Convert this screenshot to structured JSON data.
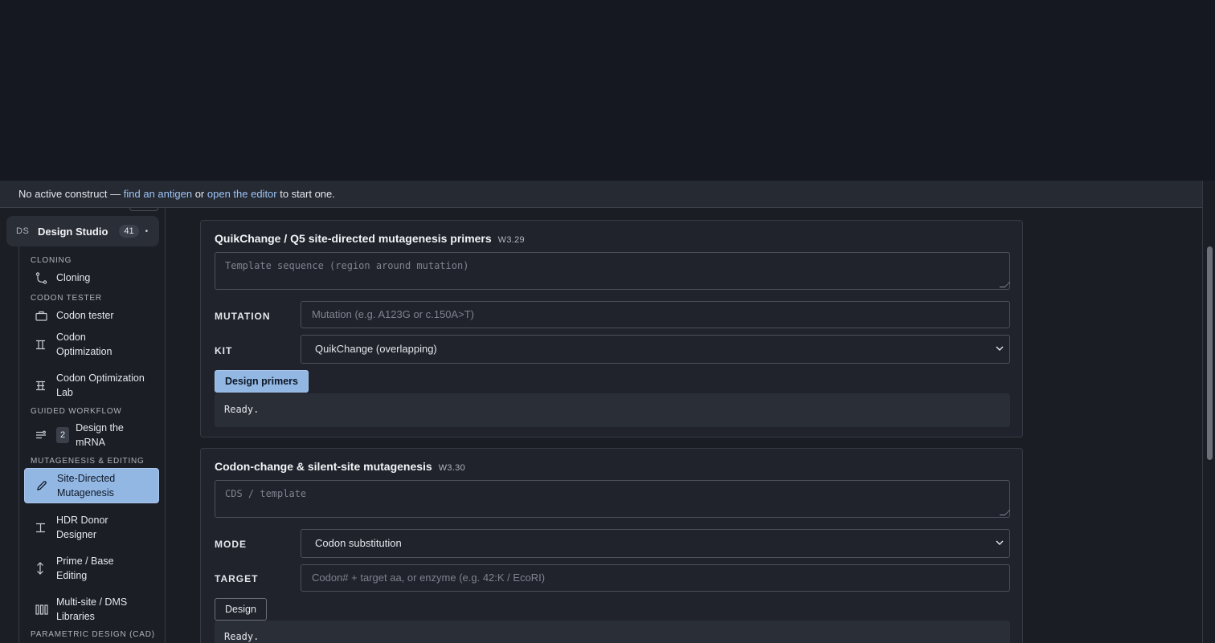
{
  "banner": {
    "prefix": "No active construct — ",
    "link1": "find an antigen",
    "middle": " or ",
    "link2": "open the editor",
    "suffix": " to start one."
  },
  "sidebar": {
    "header": {
      "abbr": "DS",
      "title": "Design Studio",
      "count": "41",
      "dot": "•"
    },
    "sections": {
      "cloning": "CLONING",
      "codon_tester": "CODON TESTER",
      "guided_workflow": "GUIDED WORKFLOW",
      "mutagenesis": "MUTAGENESIS & EDITING",
      "parametric": "PARAMETRIC DESIGN (CAD)"
    },
    "items": {
      "cloning": "Cloning",
      "codon_tester": "Codon tester",
      "codon_optimization": "Codon Optimization",
      "codon_optimization_lab": "Codon Optimization Lab",
      "design_mrna_badge": "2",
      "design_mrna": "Design the mRNA",
      "site_directed": "Site-Directed Mutagenesis",
      "hdr_donor": "HDR Donor Designer",
      "prime_base": "Prime / Base Editing",
      "multisite": "Multi-site / DMS Libraries"
    }
  },
  "card1": {
    "title": "QuikChange / Q5 site-directed mutagenesis primers",
    "code": "W3.29",
    "template_placeholder": "Template sequence (region around mutation)",
    "mutation_label": "MUTATION",
    "mutation_placeholder": "Mutation (e.g. A123G or c.150A>T)",
    "kit_label": "KIT",
    "kit_value": "QuikChange (overlapping)",
    "button": "Design primers",
    "output": "Ready."
  },
  "card2": {
    "title": "Codon-change & silent-site mutagenesis",
    "code": "W3.30",
    "template_placeholder": "CDS / template",
    "mode_label": "MODE",
    "mode_value": "Codon substitution",
    "target_label": "TARGET",
    "target_placeholder": "Codon# + target aa, or enzyme (e.g. 42:K  /  EcoRI)",
    "button": "Design",
    "output": "Ready."
  }
}
